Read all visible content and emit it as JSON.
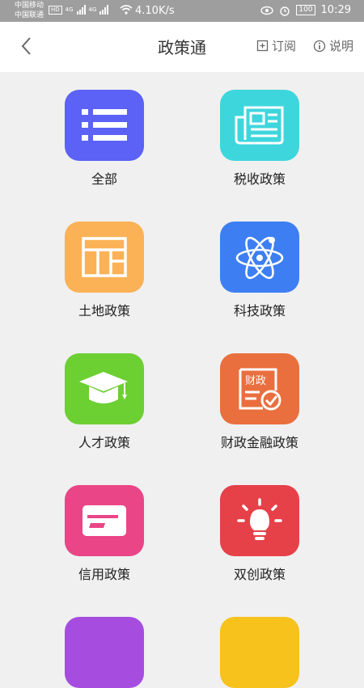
{
  "status_bar": {
    "carrier1": "中国移动",
    "carrier2": "中国联通",
    "hd_badge": "HD",
    "net1": "4G",
    "net2": "4G",
    "speed": "4.10K/s",
    "battery": "100",
    "time": "10:29"
  },
  "header": {
    "title": "政策通",
    "subscribe_label": "订阅",
    "info_label": "说明"
  },
  "categories": [
    {
      "label": "全部",
      "color": "#5b62f5",
      "icon": "list-icon"
    },
    {
      "label": "税收政策",
      "color": "#3ed6dd",
      "icon": "newspaper-icon"
    },
    {
      "label": "土地政策",
      "color": "#fbb257",
      "icon": "land-plot-icon"
    },
    {
      "label": "科技政策",
      "color": "#3d7ff2",
      "icon": "atom-icon"
    },
    {
      "label": "人才政策",
      "color": "#6ccf32",
      "icon": "graduation-cap-icon"
    },
    {
      "label": "财政金融政策",
      "color": "#ea6f3f",
      "icon": "finance-document-icon"
    },
    {
      "label": "信用政策",
      "color": "#ea4587",
      "icon": "credit-card-icon"
    },
    {
      "label": "双创政策",
      "color": "#e64049",
      "icon": "lightbulb-icon"
    },
    {
      "label": "",
      "color": "#a64de0",
      "icon": "partial-icon"
    },
    {
      "label": "",
      "color": "#f7c21c",
      "icon": "partial-icon"
    }
  ]
}
